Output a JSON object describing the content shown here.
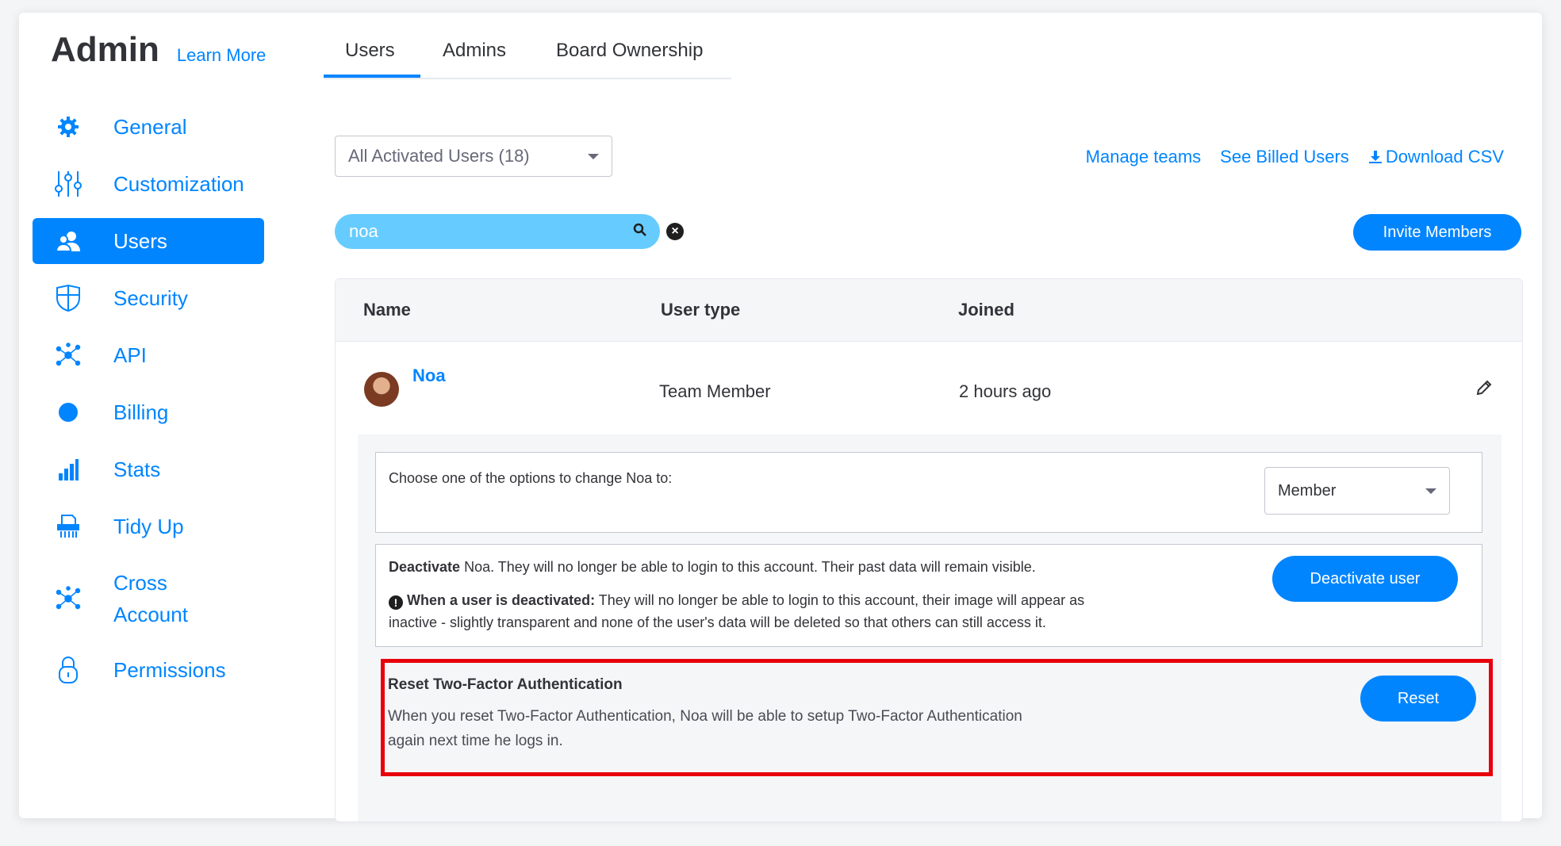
{
  "brand": {
    "title": "Admin",
    "learn_more": "Learn More"
  },
  "sidebar": {
    "items": [
      {
        "label": "General",
        "icon": "gear-icon",
        "active": false
      },
      {
        "label": "Customization",
        "icon": "sliders-icon",
        "active": false
      },
      {
        "label": "Users",
        "icon": "users-icon",
        "active": true
      },
      {
        "label": "Security",
        "icon": "shield-icon",
        "active": false
      },
      {
        "label": "API",
        "icon": "api-icon",
        "active": false
      },
      {
        "label": "Billing",
        "icon": "billing-icon",
        "active": false
      },
      {
        "label": "Stats",
        "icon": "stats-icon",
        "active": false
      },
      {
        "label": "Tidy Up",
        "icon": "shredder-icon",
        "active": false
      },
      {
        "label_line1": "Cross",
        "label_line2": "Account",
        "icon": "network-icon",
        "active": false
      },
      {
        "label": "Permissions",
        "icon": "lock-icon",
        "active": false
      }
    ]
  },
  "tabs": [
    {
      "label": "Users",
      "active": true
    },
    {
      "label": "Admins",
      "active": false
    },
    {
      "label": "Board Ownership",
      "active": false
    }
  ],
  "filter": {
    "selected": "All Activated Users (18)"
  },
  "links": {
    "manage_teams": "Manage teams",
    "billed_users": "See Billed Users",
    "download_csv": "Download CSV"
  },
  "search": {
    "value": "noa"
  },
  "invite_button": "Invite Members",
  "table": {
    "headers": {
      "name": "Name",
      "type": "User type",
      "joined": "Joined"
    },
    "row": {
      "name": "Noa",
      "type": "Team Member",
      "joined": "2 hours ago"
    }
  },
  "details": {
    "change_role": {
      "text": "Choose one of the options to change Noa to:",
      "selected": "Member"
    },
    "deactivate": {
      "bold": "Deactivate",
      "text": " Noa. They will no longer be able to login to this account. Their past data will remain visible.",
      "note_bold": "When a user is deactivated:",
      "note_text_line1": " They will no longer be able to login to this account, their image will appear as",
      "note_text_line2": "inactive - slightly transparent and none of the user's data will be deleted so that others can still access it.",
      "button": "Deactivate user"
    },
    "reset_2fa": {
      "title": "Reset Two-Factor Authentication",
      "line1": "When you reset Two-Factor Authentication, Noa will be able to setup Two-Factor Authentication",
      "line2": "again next time he logs in.",
      "button": "Reset"
    }
  },
  "colors": {
    "accent": "#0085ff",
    "search_bg": "#66ccff",
    "highlight": "#e8000b"
  }
}
